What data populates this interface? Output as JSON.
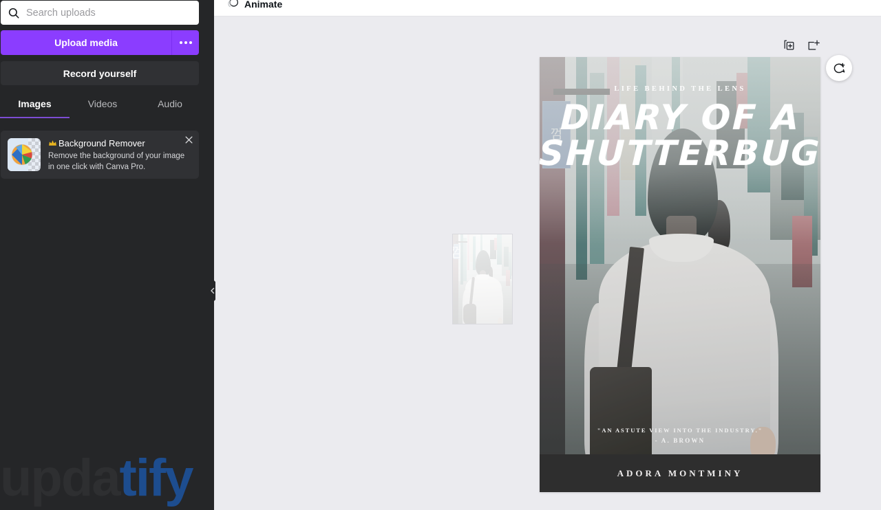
{
  "sidebar": {
    "search": {
      "placeholder": "Search uploads",
      "value": "",
      "icon": "search-icon"
    },
    "upload_button": "Upload media",
    "upload_more_icon": "ellipsis-icon",
    "record_button": "Record yourself",
    "tabs": [
      {
        "label": "Images",
        "active": true
      },
      {
        "label": "Videos",
        "active": false
      },
      {
        "label": "Audio",
        "active": false
      }
    ],
    "promo": {
      "title": "Background Remover",
      "crown_icon": "crown-icon",
      "description": "Remove the background of your image in one click with Canva Pro.",
      "close_icon": "close-icon",
      "thumb_icon": "beach-ball-image"
    },
    "watermark": {
      "dim": "upda",
      "blue": "tify"
    },
    "background_color": "#252628"
  },
  "collapse_handle": {
    "icon": "chevron-left-icon"
  },
  "topbar": {
    "animate_label": "Animate",
    "animate_icon": "animate-circles-icon"
  },
  "page_tools": [
    {
      "name": "duplicate-page-icon",
      "label": "Duplicate page"
    },
    {
      "name": "add-page-icon",
      "label": "Add page"
    }
  ],
  "comment_button": {
    "icon": "comment-add-icon"
  },
  "canvas": {
    "background_color": "#ebebef",
    "drag_ghost": {
      "name": "dragged-image-preview"
    }
  },
  "poster": {
    "kicker": "LIFE BEHIND THE LENS",
    "title_line1": "DIARY OF A",
    "title_line2": "SHUTTERBUG",
    "quote": "\"AN ASTUTE VIEW INTO THE INDUSTRY.\"",
    "quote_author": "- A. BROWN",
    "footer_name": "ADORA MONTMINY",
    "footer_color": "#2e2e2e",
    "photo_alt": "man-walking-street-photo"
  },
  "colors": {
    "accent_purple": "#8b3dff",
    "tab_underline": "#7d4dd4",
    "sidebar_bg": "#252628",
    "panel_bg": "#303134",
    "canvas_bg": "#ebebef",
    "watermark_blue": "#1d4d8f"
  }
}
